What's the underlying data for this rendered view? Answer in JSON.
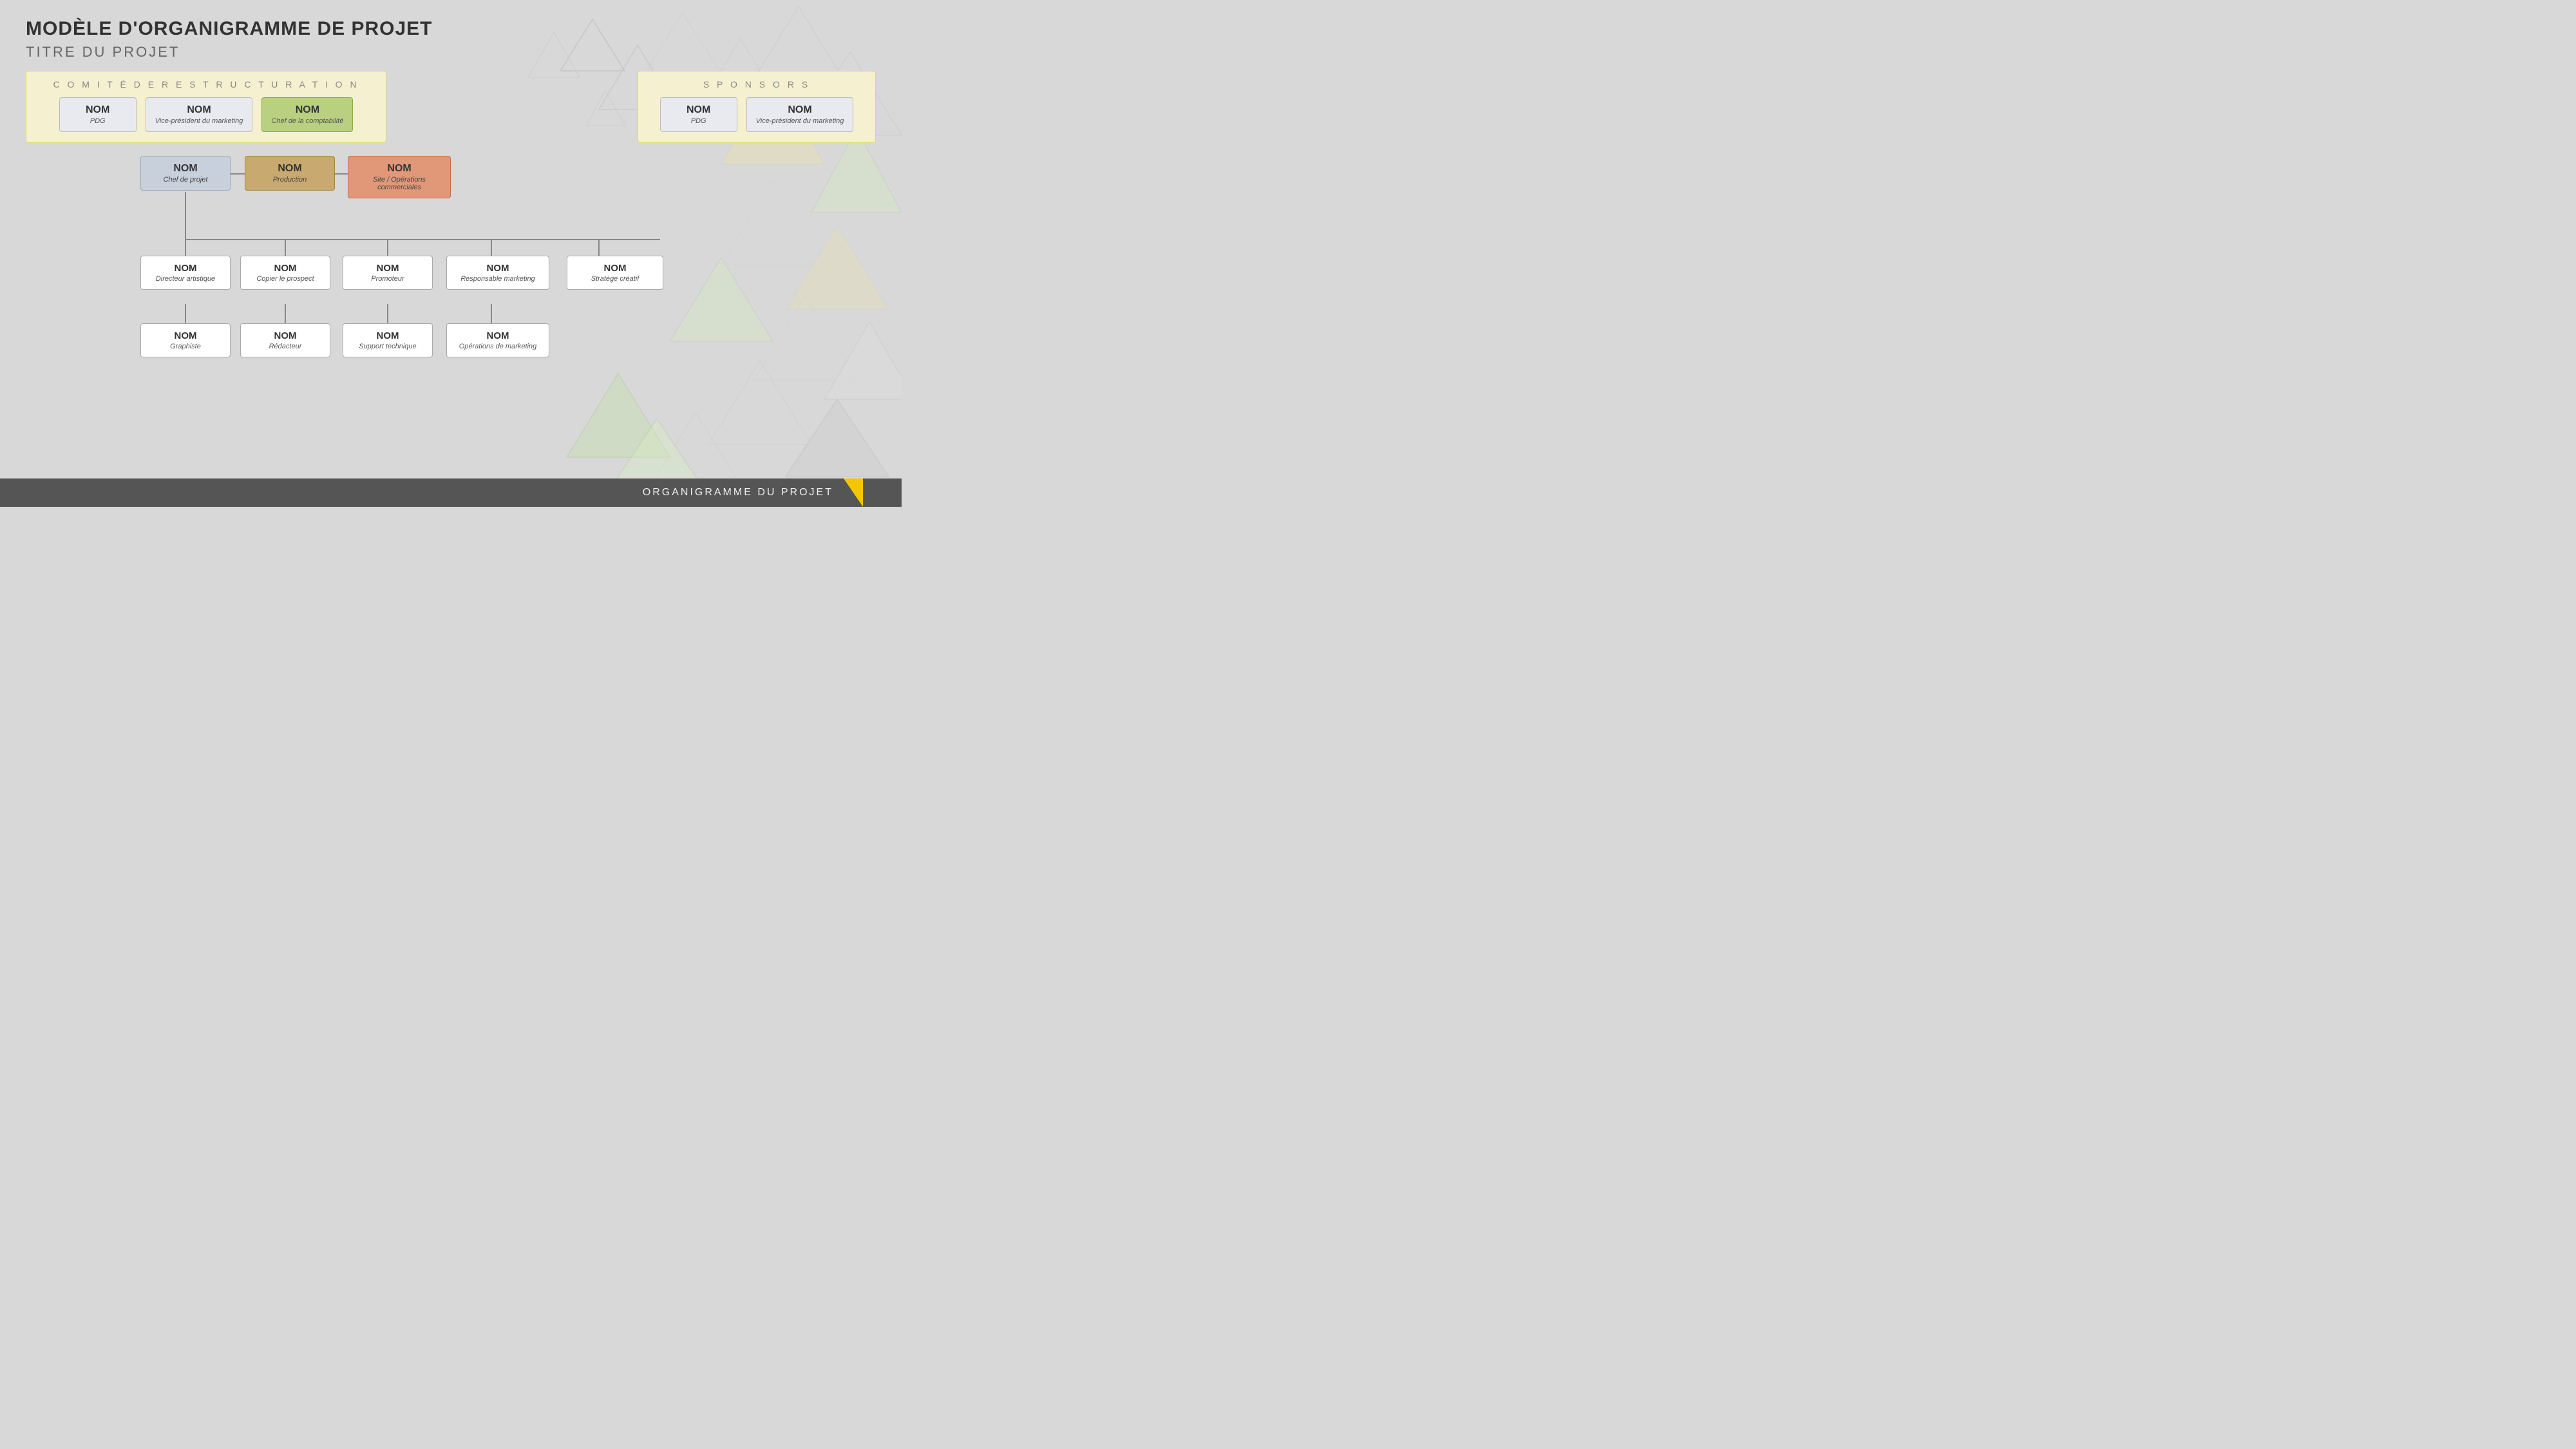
{
  "page": {
    "title": "MODÈLE D'ORGANIGRAMME DE PROJET",
    "subtitle": "TITRE DU PROJET",
    "footer": "ORGANIGRAMME DU PROJET"
  },
  "comite": {
    "title": "C O M I T É   D E   R E S T R U C T U R A T I O N",
    "members": [
      {
        "name": "NOM",
        "role": "PDG",
        "style": "normal"
      },
      {
        "name": "NOM",
        "role": "Vice-président du marketing",
        "style": "normal"
      },
      {
        "name": "NOM",
        "role": "Chef de la comptabilité",
        "style": "green"
      }
    ]
  },
  "sponsors": {
    "title": "S P O N S O R S",
    "members": [
      {
        "name": "NOM",
        "role": "PDG",
        "style": "normal"
      },
      {
        "name": "NOM",
        "role": "Vice-président du marketing",
        "style": "normal"
      }
    ]
  },
  "mid_level": [
    {
      "name": "NOM",
      "role": "Chef de projet",
      "style": "blue-grey"
    },
    {
      "name": "NOM",
      "role": "Production",
      "style": "tan"
    },
    {
      "name": "NOM",
      "role": "Site / Opérations commerciales",
      "style": "orange"
    }
  ],
  "bottom_level": [
    {
      "name": "NOM",
      "role": "Directeur artistique",
      "child": {
        "name": "NOM",
        "role": "Graphiste"
      }
    },
    {
      "name": "NOM",
      "role": "Copier le prospect",
      "child": {
        "name": "NOM",
        "role": "Rédacteur"
      }
    },
    {
      "name": "NOM",
      "role": "Promoteur",
      "child": {
        "name": "NOM",
        "role": "Support technique"
      }
    },
    {
      "name": "NOM",
      "role": "Responsable marketing",
      "child": {
        "name": "NOM",
        "role": "Opérations de marketing"
      }
    },
    {
      "name": "NOM",
      "role": "Stratège créatif",
      "child": null
    }
  ]
}
